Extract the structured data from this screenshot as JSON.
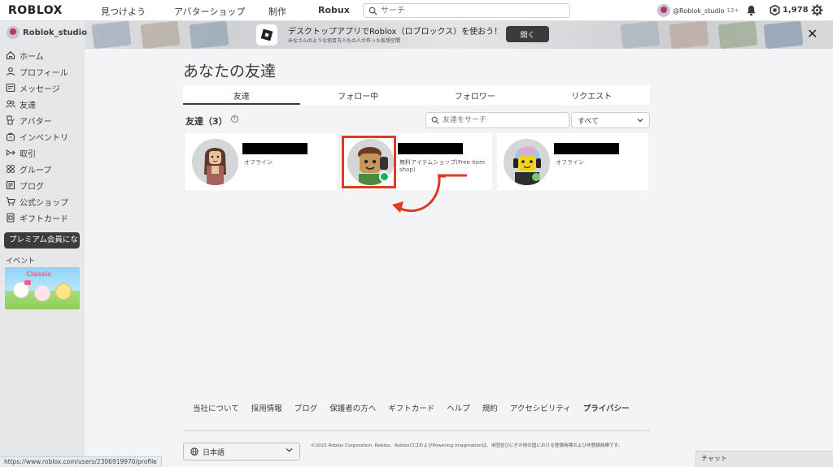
{
  "topbar": {
    "logo": "ROBLOX",
    "nav": [
      "見つけよう",
      "アバターショップ",
      "制作",
      "Robux"
    ],
    "search_placeholder": "サーチ",
    "username": "@Roblok_studio",
    "age": "13+",
    "robux": "1,978"
  },
  "banner": {
    "title": "デスクトップアプリでRoblox（ロブロックス）を使おう！",
    "subtitle": "みなさんのような何百万人もの人が作った仮想空間",
    "open_label": "開く"
  },
  "sidebar": {
    "username": "Roblok_studio",
    "items": [
      {
        "label": "ホーム",
        "icon": "home-icon"
      },
      {
        "label": "プロフィール",
        "icon": "profile-icon"
      },
      {
        "label": "メッセージ",
        "icon": "message-icon"
      },
      {
        "label": "友達",
        "icon": "friends-icon"
      },
      {
        "label": "アバター",
        "icon": "avatar-icon"
      },
      {
        "label": "インベントリ",
        "icon": "inventory-icon"
      },
      {
        "label": "取引",
        "icon": "trade-icon"
      },
      {
        "label": "グループ",
        "icon": "groups-icon"
      },
      {
        "label": "ブログ",
        "icon": "blog-icon"
      },
      {
        "label": "公式ショップ",
        "icon": "shop-icon"
      },
      {
        "label": "ギフトカード",
        "icon": "giftcard-icon"
      }
    ],
    "premium_label": "プレミアム会員にな",
    "events_label": "イベント",
    "event_title": "Classic"
  },
  "main": {
    "title": "あなたの友達",
    "tabs": [
      {
        "label": "友達",
        "active": true
      },
      {
        "label": "フォロー中",
        "active": false
      },
      {
        "label": "フォロワー",
        "active": false
      },
      {
        "label": "リクエスト",
        "active": false
      }
    ],
    "friends_heading": "友達（3）",
    "friend_search_placeholder": "友達をサーチ",
    "filter_value": "すべて",
    "friends": [
      {
        "status": "オフライン",
        "online": false
      },
      {
        "status": "無料アイテムショップ(Free item shop)",
        "online": true
      },
      {
        "status": "オフライン",
        "online": false
      }
    ]
  },
  "footer": {
    "links": [
      "当社について",
      "採用情報",
      "ブログ",
      "保護者の方へ",
      "ギフトカード",
      "ヘルプ",
      "規約",
      "アクセシビリティ",
      "プライバシー"
    ],
    "language": "日本語",
    "copyright": "©2023 Roblox Corporation. Roblox、RobloxロゴおよびPowering Imaginationは、米国並びにその他の国における登録商標および非登録商標です。",
    "chat_label": "チャット",
    "status_url": "https://www.roblox.com/users/2306919970/profile"
  },
  "colors": {
    "highlight": "#e03b1f",
    "online": "#02b757",
    "dark": "#393b3d"
  }
}
